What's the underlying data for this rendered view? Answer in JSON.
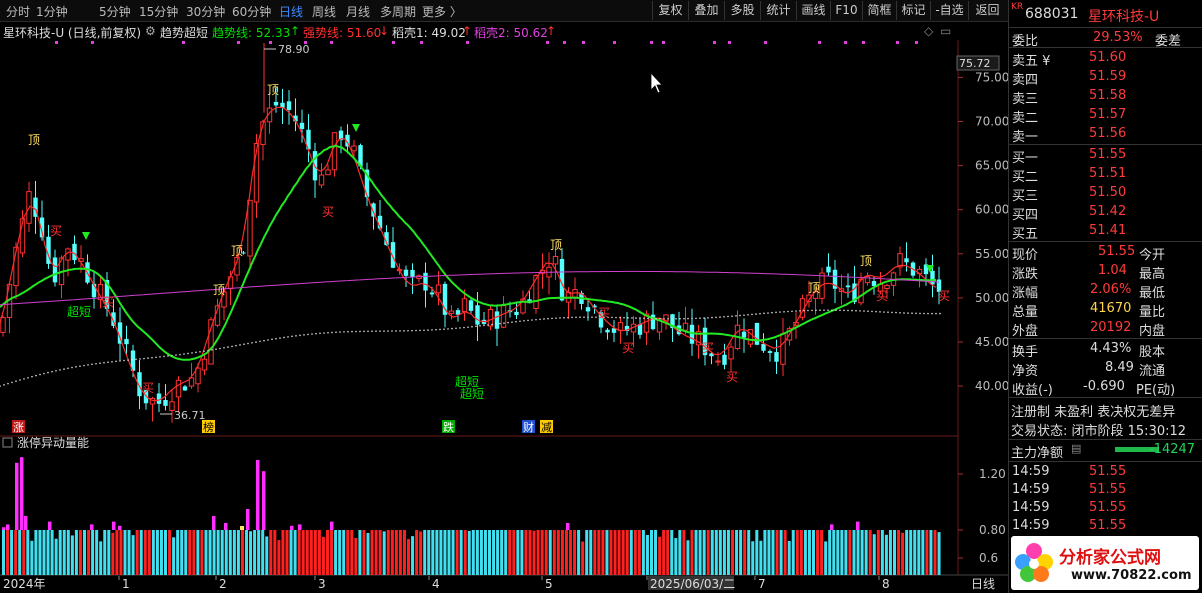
{
  "toolbar": {
    "periods": [
      "分时",
      "1分钟",
      "5分钟",
      "15分钟",
      "30分钟",
      "60分钟",
      "日线",
      "周线",
      "月线",
      "多周期",
      "更多 〉"
    ],
    "active_period": "日线",
    "tools": [
      "复权",
      "叠加",
      "多股",
      "统计",
      "画线",
      "F10",
      "简框",
      "标记",
      "-自选",
      "返回"
    ]
  },
  "indicator_bar": {
    "title": "星环科技-U (日线,前复权)",
    "indicator_name": "趋势超短",
    "items": [
      {
        "text": "趋势线: 52.33",
        "arrow": "↑",
        "color": "#00e000"
      },
      {
        "text": "强势线: 51.60",
        "arrow": "↓",
        "color": "#ff3030"
      },
      {
        "text": "稻壳1: 49.02",
        "arrow": "↑",
        "color": "#dddddd"
      },
      {
        "text": "稻壳2: 50.62",
        "arrow": "↑",
        "color": "#e040e0"
      }
    ]
  },
  "main_chart": {
    "y_ticks": [
      "75.00",
      "70.00",
      "65.00",
      "60.00",
      "55.00",
      "50.00",
      "45.00",
      "40.00"
    ],
    "top_price_box": "75.72",
    "max_label": "78.90",
    "min_label": "36.71",
    "signals": [
      {
        "text": "顶",
        "color": "#ffe060"
      },
      {
        "text": "顶",
        "color": "#ffe060"
      },
      {
        "text": "顶",
        "color": "#ffe060"
      },
      {
        "text": "顶",
        "color": "#ffe060"
      },
      {
        "text": "顶",
        "color": "#ffe060"
      },
      {
        "text": "顶",
        "color": "#ffe060"
      },
      {
        "text": "顶",
        "color": "#ffe060"
      },
      {
        "text": "超短",
        "color": "#00e000"
      },
      {
        "text": "超短",
        "color": "#00e000"
      },
      {
        "text": "超短",
        "color": "#00e000"
      },
      {
        "text": "买",
        "color": "#ff3030"
      },
      {
        "text": "买",
        "color": "#ff3030"
      },
      {
        "text": "买",
        "color": "#ff3030"
      },
      {
        "text": "买",
        "color": "#ff3030"
      },
      {
        "text": "买",
        "color": "#ff3030"
      },
      {
        "text": "买",
        "color": "#ff3030"
      },
      {
        "text": "买",
        "color": "#ff3030"
      },
      {
        "text": "买",
        "color": "#ff3030"
      },
      {
        "text": "买",
        "color": "#ff3030"
      },
      {
        "text": "买",
        "color": "#ff3030"
      }
    ],
    "event_marks": [
      {
        "text": "涨",
        "bg": "#c01818",
        "color": "#ffffff"
      },
      {
        "text": "榜",
        "bg": "#ffcc00",
        "color": "#000000"
      },
      {
        "text": "跌",
        "bg": "#00aa00",
        "color": "#ffffff"
      },
      {
        "text": "财",
        "bg": "#2050d0",
        "color": "#ffffff"
      },
      {
        "text": "减",
        "bg": "#ffcc00",
        "color": "#000000"
      }
    ]
  },
  "sub_panel": {
    "title": "涨停异动量能",
    "y_ticks": [
      "1.20",
      "0.80",
      "0.6"
    ]
  },
  "x_axis": {
    "labels": [
      "2024年",
      "1",
      "2",
      "3",
      "4",
      "5",
      "2025/06/03/二",
      "7",
      "8",
      "日线"
    ]
  },
  "right_panel": {
    "header_code": "688031",
    "header_name": "星环科技-U",
    "header_mark": "KR",
    "order_ratio": {
      "label": "委比",
      "value": "29.53%",
      "label2": "委差"
    },
    "asks": [
      {
        "label": "卖五 ¥",
        "price": "51.60"
      },
      {
        "label": "卖四",
        "price": "51.59"
      },
      {
        "label": "卖三",
        "price": "51.58"
      },
      {
        "label": "卖二",
        "price": "51.57"
      },
      {
        "label": "卖一",
        "price": "51.56"
      }
    ],
    "bids": [
      {
        "label": "买一",
        "price": "51.55"
      },
      {
        "label": "买二",
        "price": "51.51"
      },
      {
        "label": "买三",
        "price": "51.50"
      },
      {
        "label": "买四",
        "price": "51.42"
      },
      {
        "label": "买五",
        "price": "51.41"
      }
    ],
    "quote": [
      {
        "l1": "现价",
        "v1": "51.55",
        "c1": "#ff3b3b",
        "l2": "今开"
      },
      {
        "l1": "涨跌",
        "v1": "1.04",
        "c1": "#ff3b3b",
        "l2": "最高"
      },
      {
        "l1": "涨幅",
        "v1": "2.06%",
        "c1": "#ff3b3b",
        "l2": "最低"
      },
      {
        "l1": "总量",
        "v1": "41670",
        "c1": "#ffd24a",
        "l2": "量比"
      },
      {
        "l1": "外盘",
        "v1": "20192",
        "c1": "#ff3b3b",
        "l2": "内盘"
      }
    ],
    "stats": [
      {
        "l1": "换手",
        "v1": "4.43%",
        "l2": "股本"
      },
      {
        "l1": "净资",
        "v1": "8.49",
        "l2": "流通"
      },
      {
        "l1": "收益(-)",
        "v1": "-0.690",
        "l2": "PE(动)"
      }
    ],
    "tags": "注册制 未盈利 表决权无差异",
    "trade_status": "交易状态: 闭市阶段 15:30:12",
    "main_flow": {
      "label": "主力净额",
      "value": "-14247"
    },
    "ticks": [
      {
        "time": "14:59",
        "price": "51.55"
      },
      {
        "time": "14:59",
        "price": "51.55"
      },
      {
        "time": "14:59",
        "price": "51.55"
      },
      {
        "time": "14:59",
        "price": "51.55"
      }
    ],
    "watermark_name": "分析家公式网",
    "watermark_url": "www.70822.com"
  }
}
